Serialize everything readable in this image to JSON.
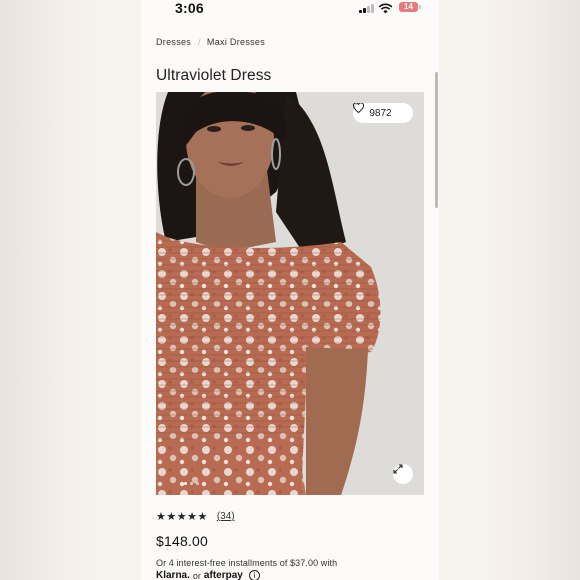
{
  "status_bar": {
    "time": "3:06",
    "battery": "14",
    "battery_color": "#e7797b"
  },
  "breadcrumb": {
    "items": [
      "Dresses",
      "Maxi Dresses"
    ]
  },
  "product": {
    "title": "Ultraviolet Dress",
    "wishlist_count": "9872",
    "image_icons": [
      "heart-icon",
      "expand-icon"
    ],
    "rating": {
      "stars": "★★★★★",
      "value": 4.5,
      "max": 5,
      "review_count": "(34)"
    },
    "price": "$148.00",
    "installments_text": "Or 4 interest-free installments of $37.00 with",
    "klarna_label": "Klarna.",
    "or_label": "or",
    "afterpay_label": "afterpay",
    "info_label": "i"
  },
  "image_carousel": {
    "total": 3,
    "active": 0
  }
}
